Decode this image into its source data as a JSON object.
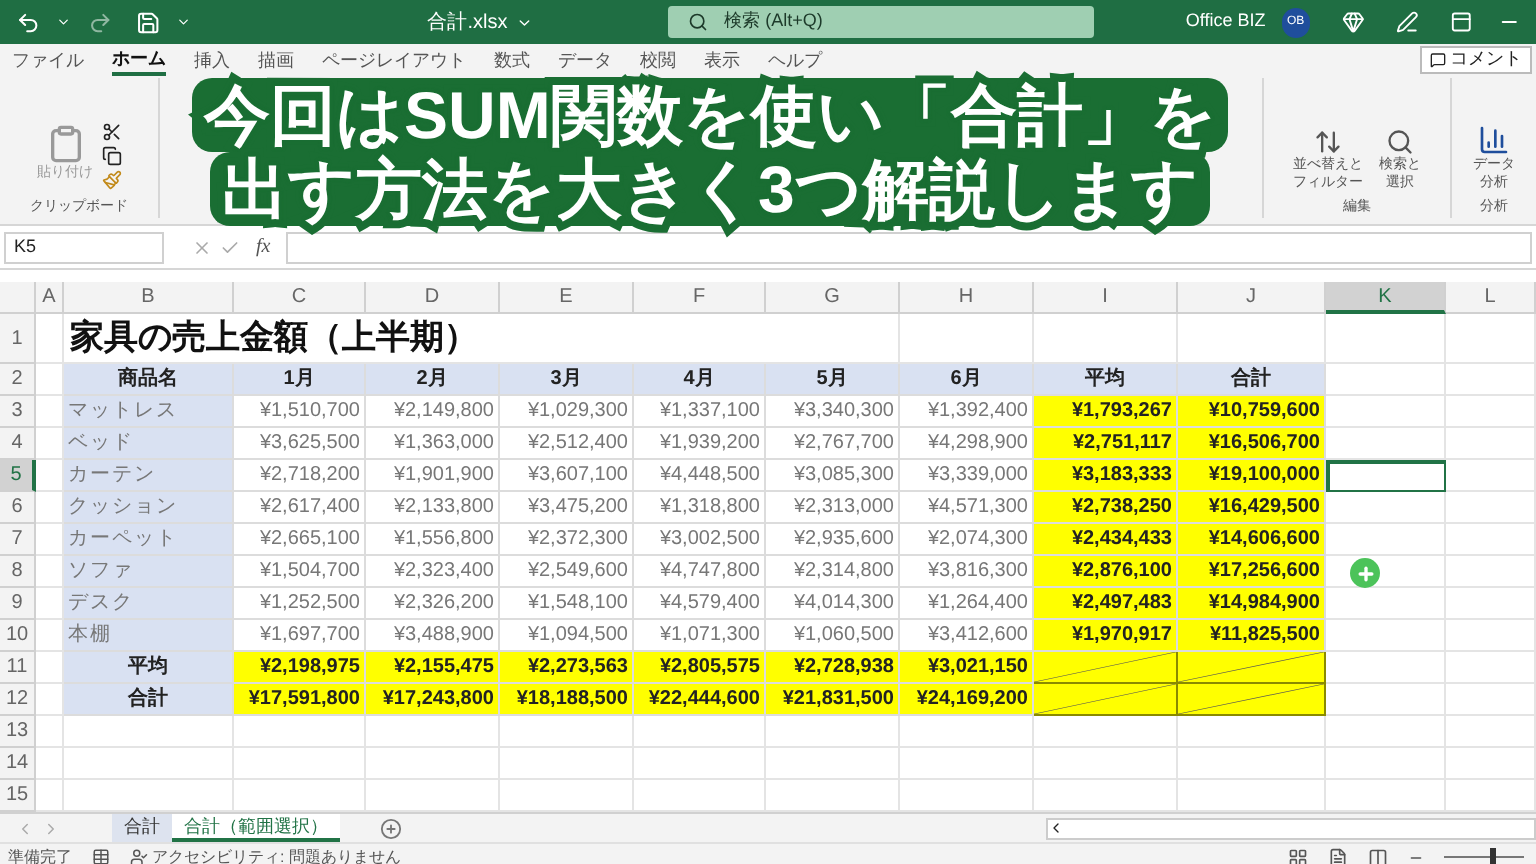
{
  "title_bar": {
    "file_name": "合計.xlsx",
    "search_placeholder": "検索 (Alt+Q)",
    "account_name": "Office BIZ",
    "avatar_initials": "OB"
  },
  "ribbon_tabs": [
    {
      "label": "ファイル",
      "selected": false
    },
    {
      "label": "ホーム",
      "selected": true
    },
    {
      "label": "挿入",
      "selected": false
    },
    {
      "label": "描画",
      "selected": false
    },
    {
      "label": "ページレイアウト",
      "selected": false
    },
    {
      "label": "数式",
      "selected": false
    },
    {
      "label": "データ",
      "selected": false
    },
    {
      "label": "校閲",
      "selected": false
    },
    {
      "label": "表示",
      "selected": false
    },
    {
      "label": "ヘルプ",
      "selected": false
    }
  ],
  "comment_button": "コメント",
  "ribbon_left": {
    "paste": "貼り付け",
    "group": "クリップボード"
  },
  "ribbon_right": {
    "sort_filter": "並べ替えとフィルター",
    "find_select": "検索と選択",
    "edit_group": "編集",
    "data_analysis": "データ分析",
    "analysis_group": "分析"
  },
  "caption": {
    "lines": [
      "今回はSUM関数を使い「合計」を",
      "出す方法を大きく3つ解説します"
    ]
  },
  "formula_bar": {
    "name_box": "K5",
    "fx": "fx"
  },
  "columns": [
    {
      "label": "A",
      "selected": false
    },
    {
      "label": "B",
      "selected": false
    },
    {
      "label": "C",
      "selected": false
    },
    {
      "label": "D",
      "selected": false
    },
    {
      "label": "E",
      "selected": false
    },
    {
      "label": "F",
      "selected": false
    },
    {
      "label": "G",
      "selected": false
    },
    {
      "label": "H",
      "selected": false
    },
    {
      "label": "I",
      "selected": false
    },
    {
      "label": "J",
      "selected": false
    },
    {
      "label": "K",
      "selected": true
    },
    {
      "label": "L",
      "selected": false
    }
  ],
  "row_numbers": [
    {
      "label": "1",
      "selected": false
    },
    {
      "label": "2",
      "selected": false
    },
    {
      "label": "3",
      "selected": false
    },
    {
      "label": "4",
      "selected": false
    },
    {
      "label": "5",
      "selected": true
    },
    {
      "label": "6",
      "selected": false
    },
    {
      "label": "7",
      "selected": false
    },
    {
      "label": "8",
      "selected": false
    },
    {
      "label": "9",
      "selected": false
    },
    {
      "label": "10",
      "selected": false
    },
    {
      "label": "11",
      "selected": false
    },
    {
      "label": "12",
      "selected": false
    },
    {
      "label": "13",
      "selected": false
    },
    {
      "label": "14",
      "selected": false
    },
    {
      "label": "15",
      "selected": false
    }
  ],
  "sheet_title": "家具の売上金額（上半期）",
  "table": {
    "header": [
      "商品名",
      "1月",
      "2月",
      "3月",
      "4月",
      "5月",
      "6月",
      "平均",
      "合計"
    ],
    "rows": [
      {
        "name": "マットレス",
        "values": [
          "¥1,510,700",
          "¥2,149,800",
          "¥1,029,300",
          "¥1,337,100",
          "¥3,340,300",
          "¥1,392,400"
        ],
        "average": "¥1,793,267",
        "total": "¥10,759,600"
      },
      {
        "name": "ベッド",
        "values": [
          "¥3,625,500",
          "¥1,363,000",
          "¥2,512,400",
          "¥1,939,200",
          "¥2,767,700",
          "¥4,298,900"
        ],
        "average": "¥2,751,117",
        "total": "¥16,506,700"
      },
      {
        "name": "カーテン",
        "values": [
          "¥2,718,200",
          "¥1,901,900",
          "¥3,607,100",
          "¥4,448,500",
          "¥3,085,300",
          "¥3,339,000"
        ],
        "average": "¥3,183,333",
        "total": "¥19,100,000"
      },
      {
        "name": "クッション",
        "values": [
          "¥2,617,400",
          "¥2,133,800",
          "¥3,475,200",
          "¥1,318,800",
          "¥2,313,000",
          "¥4,571,300"
        ],
        "average": "¥2,738,250",
        "total": "¥16,429,500"
      },
      {
        "name": "カーペット",
        "values": [
          "¥2,665,100",
          "¥1,556,800",
          "¥2,372,300",
          "¥3,002,500",
          "¥2,935,600",
          "¥2,074,300"
        ],
        "average": "¥2,434,433",
        "total": "¥14,606,600"
      },
      {
        "name": "ソファ",
        "values": [
          "¥1,504,700",
          "¥2,323,400",
          "¥2,549,600",
          "¥4,747,800",
          "¥2,314,800",
          "¥3,816,300"
        ],
        "average": "¥2,876,100",
        "total": "¥17,256,600"
      },
      {
        "name": "デスク",
        "values": [
          "¥1,252,500",
          "¥2,326,200",
          "¥1,548,100",
          "¥4,579,400",
          "¥4,014,300",
          "¥1,264,400"
        ],
        "average": "¥2,497,483",
        "total": "¥14,984,900"
      },
      {
        "name": "本棚",
        "values": [
          "¥1,697,700",
          "¥3,488,900",
          "¥1,094,500",
          "¥1,071,300",
          "¥1,060,500",
          "¥3,412,600"
        ],
        "average": "¥1,970,917",
        "total": "¥11,825,500"
      }
    ],
    "summary": [
      {
        "label": "平均",
        "values": [
          "¥2,198,975",
          "¥2,155,475",
          "¥2,273,563",
          "¥2,805,575",
          "¥2,728,938",
          "¥3,021,150"
        ]
      },
      {
        "label": "合計",
        "values": [
          "¥17,591,800",
          "¥17,243,800",
          "¥18,188,500",
          "¥22,444,600",
          "¥21,831,500",
          "¥24,169,200"
        ]
      }
    ]
  },
  "sheet_tabs": [
    {
      "label": "合計",
      "selected": false
    },
    {
      "label": "合計（範囲選択）",
      "selected": true
    }
  ],
  "status_bar": {
    "ready": "準備完了",
    "accessibility": "アクセシビリティ: 問題ありません",
    "zoom": {
      "level": 0.6
    }
  }
}
